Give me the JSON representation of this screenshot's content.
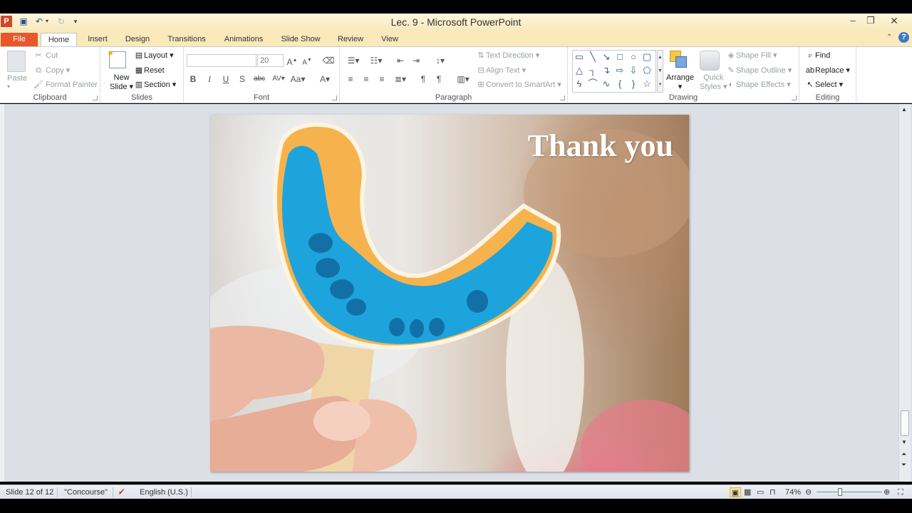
{
  "window": {
    "title": "Lec. 9  -  Microsoft PowerPoint"
  },
  "tabs": [
    {
      "label": "File"
    },
    {
      "label": "Home"
    },
    {
      "label": "Insert"
    },
    {
      "label": "Design"
    },
    {
      "label": "Transitions"
    },
    {
      "label": "Animations"
    },
    {
      "label": "Slide Show"
    },
    {
      "label": "Review"
    },
    {
      "label": "View"
    }
  ],
  "ribbon": {
    "clipboard": {
      "label": "Clipboard",
      "paste": "Paste",
      "cut": "Cut",
      "copy": "Copy",
      "format_painter": "Format Painter"
    },
    "slides": {
      "label": "Slides",
      "new_slide": "New",
      "new_slide2": "Slide",
      "layout": "Layout",
      "reset": "Reset",
      "section": "Section"
    },
    "font": {
      "label": "Font",
      "font_name": "",
      "font_size": "20"
    },
    "paragraph": {
      "label": "Paragraph",
      "text_direction": "Text Direction",
      "align_text": "Align Text",
      "convert_smartart": "Convert to SmartArt"
    },
    "drawing": {
      "label": "Drawing",
      "arrange": "Arrange",
      "quick": "Quick",
      "styles": "Styles",
      "shape_fill": "Shape Fill",
      "shape_outline": "Shape Outline",
      "shape_effects": "Shape Effects"
    },
    "editing": {
      "label": "Editing",
      "find": "Find",
      "replace": "Replace",
      "select": "Select"
    }
  },
  "slide": {
    "title": "Thank you"
  },
  "status": {
    "slide_count": "Slide 12 of 12",
    "theme": "\"Concourse\"",
    "language": "English (U.S.)",
    "zoom": "74%"
  },
  "colors": {
    "file_tab": "#e7582a",
    "title_bar": "#f9e9bb",
    "slide_title": "#ffffff",
    "tray_blue": "#1ea4dd",
    "tray_orange": "#f1a13c"
  }
}
